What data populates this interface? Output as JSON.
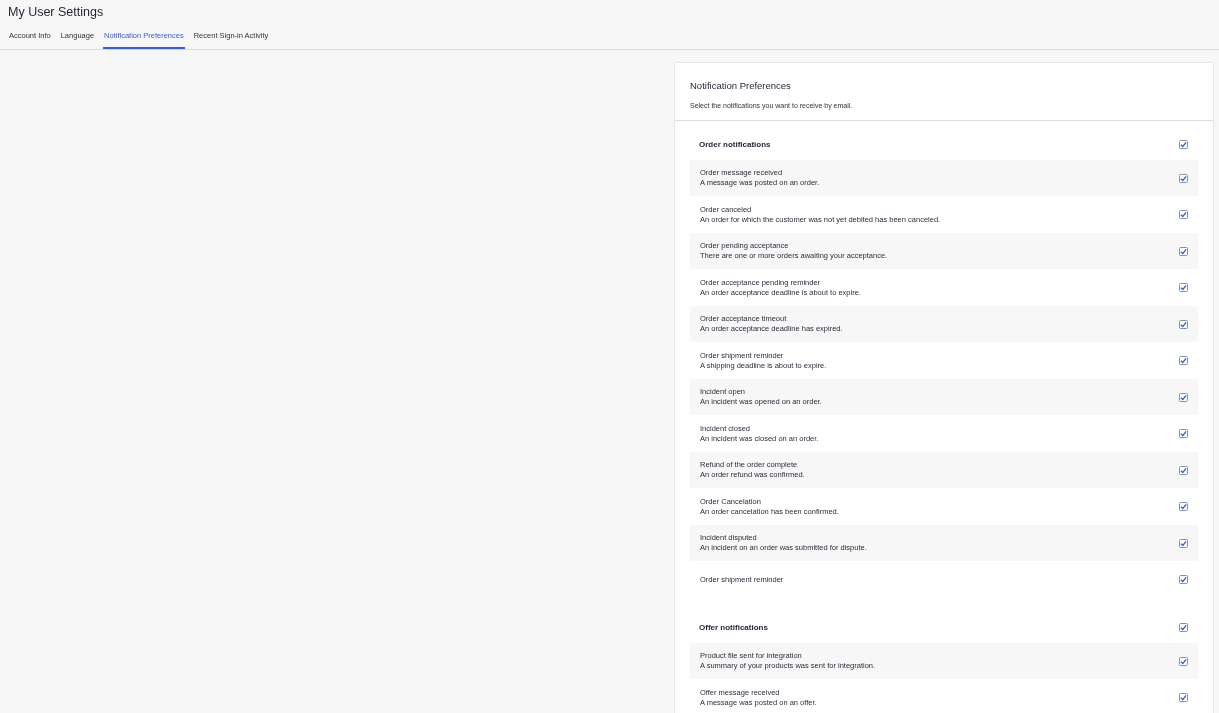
{
  "page_title": "My User Settings",
  "tabs": [
    {
      "label": "Account Info",
      "selected": false
    },
    {
      "label": "Language",
      "selected": false
    },
    {
      "label": "Notification Preferences",
      "selected": true
    },
    {
      "label": "Recent Sign-in Activity",
      "selected": false
    }
  ],
  "panel": {
    "title": "Notification Preferences",
    "subtitle": "Select the notifications you want to receive by email.",
    "groups": [
      {
        "title": "Order notifications",
        "checked": true,
        "items": [
          {
            "title": "Order message received",
            "description": "A message was posted on an order.",
            "checked": true
          },
          {
            "title": "Order canceled",
            "description": "An order for which the customer was not yet debited has been canceled.",
            "checked": true
          },
          {
            "title": "Order pending acceptance",
            "description": "There are one or more orders awaiting your acceptance.",
            "checked": true
          },
          {
            "title": "Order acceptance pending reminder",
            "description": "An order acceptance deadline is about to expire.",
            "checked": true
          },
          {
            "title": "Order acceptance timeout",
            "description": "An order acceptance deadline has expired.",
            "checked": true
          },
          {
            "title": "Order shipment reminder",
            "description": "A shipping deadline is about to expire.",
            "checked": true
          },
          {
            "title": "Incident open",
            "description": "An incident was opened on an order.",
            "checked": true
          },
          {
            "title": "Incident closed",
            "description": "An incident was closed on an order.",
            "checked": true
          },
          {
            "title": "Refund of the order complete",
            "description": "An order refund was confirmed.",
            "checked": true
          },
          {
            "title": "Order Cancelation",
            "description": "An order cancelation has been confirmed.",
            "checked": true
          },
          {
            "title": "Incident disputed",
            "description": "An incident on an order was submitted for dispute.",
            "checked": true
          },
          {
            "title": "Order shipment reminder",
            "checked": true
          }
        ]
      },
      {
        "title": "Offer notifications",
        "checked": true,
        "items": [
          {
            "title": "Product file sent for integration",
            "description": "A summary of your products was sent for integration.",
            "checked": true
          },
          {
            "title": "Offer message received",
            "description": "A message was posted on an offer.",
            "checked": true
          }
        ]
      }
    ]
  }
}
